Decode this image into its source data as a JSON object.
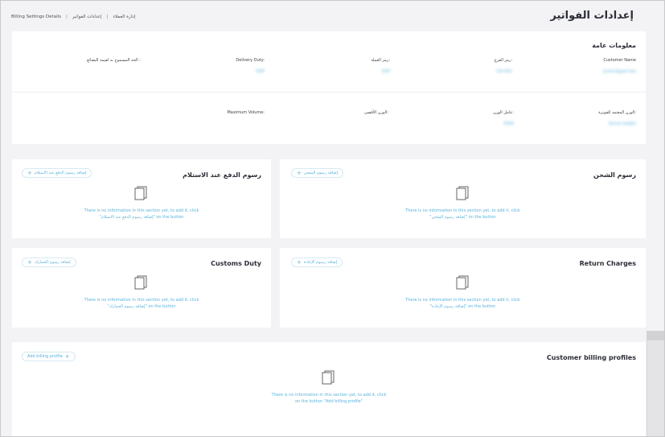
{
  "header": {
    "title": "إعدادات الفواتير",
    "breadcrumb": [
      "إدارة العملاء",
      "إعدادات الفواتير",
      "Billing Settings Details"
    ]
  },
  "general_info": {
    "title": "معلومات عامة",
    "row1": [
      {
        "label": "Customer Name",
        "value": "Jumia Egypt test"
      },
      {
        "label": "رمز الفرع:",
        "value": "CAI-001"
      },
      {
        "label": "رمز العملة:",
        "value": "EGP"
      },
      {
        "label": "Delivery Duty:",
        "value": "DDP"
      },
      {
        "label": "الحد المسموح به لقيمة البضائع :",
        "value": ""
      }
    ],
    "row2": [
      {
        "label": "الوزن المعتمد للفوترة:",
        "value": "Actual weight"
      },
      {
        "label": "عامل الوزن:",
        "value": "5000"
      },
      {
        "label": "الوزن الأقصى:",
        "value": ""
      },
      {
        "label": "Maximum Volume:",
        "value": ""
      }
    ]
  },
  "sections": {
    "shipping": {
      "title": "رسوم الشحن",
      "add_label": "إضافة رسوم الشحن",
      "empty_line1": "There is no information in this section yet, to add it, click",
      "empty_line2": "\"إضافة رسوم الشحن\" on the button"
    },
    "cod": {
      "title": "رسوم الدفع عند الاستلام",
      "add_label": "إضافة رسوم الدفع عند الاستلام",
      "empty_line1": "There is no information in this section yet, to add it, click",
      "empty_line2": "\"إضافة رسوم الدفع عند الاستلام\" on the button"
    },
    "return": {
      "title": "Return Charges",
      "add_label": "إضافة رسوم الإعادة",
      "empty_line1": "There is no information in this section yet, to add it, click",
      "empty_line2": "\"إضافة رسوم الإعادة\" on the button"
    },
    "customs": {
      "title": "Customs Duty",
      "add_label": "إضافة رسوم الجمارك",
      "empty_line1": "There is no information in this section yet, to add it, click",
      "empty_line2": "\"إضافة رسوم الجمارك\" on the button"
    },
    "profiles": {
      "title": "Customer billing profiles",
      "add_label": "Add billing profile",
      "empty_line1": "There is no information in this section yet, to add it, click",
      "empty_line2": "on the button \"Add billing profile\""
    }
  },
  "colors": {
    "accent": "#5ab2db",
    "card": "#ffffff",
    "background": "#f3f3f5",
    "title": "#2b2e36"
  },
  "icons": {
    "add": "plus-icon",
    "empty": "document-icon"
  }
}
